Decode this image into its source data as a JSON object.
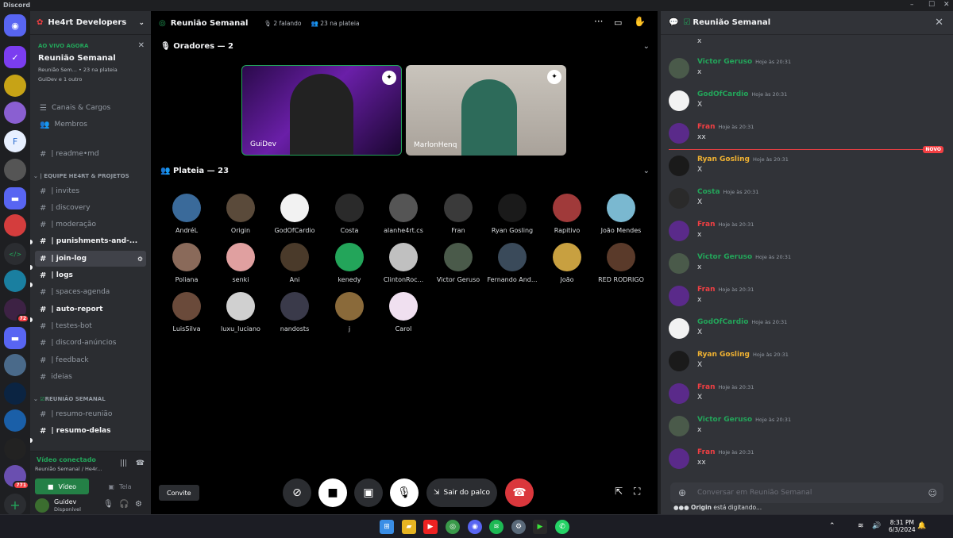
{
  "app": {
    "title": "Discord"
  },
  "guild": {
    "name": "He4rt Developers"
  },
  "live": {
    "label": "AO VIVO AGORA",
    "title": "Reunião Semanal",
    "sub1": "Reunião Sem...",
    "audience": "23 na plateia",
    "sub2": "GuiDev e 1 outro"
  },
  "nav": {
    "roles": "Canais & Cargos",
    "members": "Membros"
  },
  "channels": [
    {
      "label": "| readme•md",
      "bold": false
    },
    {
      "cat": "| EQUIPE HE4RT & PROJETOS"
    },
    {
      "label": "| invites",
      "bold": false
    },
    {
      "label": "| discovery",
      "bold": false
    },
    {
      "label": "| moderação",
      "bold": false
    },
    {
      "label": "| punishments-and-...",
      "bold": true
    },
    {
      "label": "| join-log",
      "bold": true,
      "selected": true
    },
    {
      "label": "| logs",
      "bold": true
    },
    {
      "label": "| spaces-agenda",
      "bold": false
    },
    {
      "label": "| auto-report",
      "bold": true
    },
    {
      "label": "| testes-bot",
      "bold": false
    },
    {
      "label": "| discord-anúncios",
      "bold": false
    },
    {
      "label": "| feedback",
      "bold": false
    },
    {
      "label": "ideias",
      "bold": false
    },
    {
      "cat": "REUNIÃO SEMANAL"
    },
    {
      "label": "| resumo-reunião",
      "bold": false
    },
    {
      "label": "| resumo-delas",
      "bold": true
    }
  ],
  "voice": {
    "status": "Vídeo conectado",
    "where": "Reunião Semanal / He4r...",
    "video": "Vídeo",
    "screen": "Tela"
  },
  "user": {
    "name": "Guidev",
    "status": "Disponível"
  },
  "stage": {
    "title": "Reunião Semanal",
    "speaking": "2 falando",
    "audience": "23 na plateia",
    "speakers_label": "Oradores — 2",
    "audience_label": "Plateia — 23"
  },
  "speakers": [
    {
      "name": "GuiDev"
    },
    {
      "name": "MarlonHenq"
    }
  ],
  "audience": [
    "AndréL",
    "Origin",
    "GodOfCardio",
    "Costa",
    "alanhe4rt.cs",
    "Fran",
    "Ryan Gosling",
    "Rapitivo",
    "João Mendes",
    "Poliana",
    "senki",
    "Ani",
    "kenedy",
    "ClintonRoc...",
    "Victor Geruso",
    "Fernando And...",
    "João",
    "RED RODRIGO",
    "LuisSilva",
    "luxu_luciano",
    "nandosts",
    "j",
    "Carol"
  ],
  "controls": {
    "invite": "Convite",
    "leave": "Sair do palco"
  },
  "chat": {
    "title": "Reunião Semanal",
    "first_text": "x",
    "messages": [
      {
        "author": "Victor Geruso",
        "time": "Hoje às 20:31",
        "text": "x",
        "color": "#23a55a"
      },
      {
        "author": "GodOfCardio",
        "time": "Hoje às 20:31",
        "text": "X",
        "color": "#23a55a"
      },
      {
        "author": "Fran",
        "time": "Hoje às 20:31",
        "text": "xx",
        "color": "#f23f43"
      },
      {
        "author": "Ryan Gosling",
        "time": "Hoje às 20:31",
        "text": "X",
        "color": "#f0b232"
      },
      {
        "author": "Costa",
        "time": "Hoje às 20:31",
        "text": "X",
        "color": "#23a55a"
      },
      {
        "author": "Fran",
        "time": "Hoje às 20:31",
        "text": "x",
        "color": "#f23f43"
      },
      {
        "author": "Victor Geruso",
        "time": "Hoje às 20:31",
        "text": "x",
        "color": "#23a55a"
      },
      {
        "author": "Fran",
        "time": "Hoje às 20:31",
        "text": "x",
        "color": "#f23f43"
      },
      {
        "author": "GodOfCardio",
        "time": "Hoje às 20:31",
        "text": "X",
        "color": "#23a55a"
      },
      {
        "author": "Ryan Gosling",
        "time": "Hoje às 20:31",
        "text": "X",
        "color": "#f0b232"
      },
      {
        "author": "Fran",
        "time": "Hoje às 20:31",
        "text": "X",
        "color": "#f23f43"
      },
      {
        "author": "Victor Geruso",
        "time": "Hoje às 20:31",
        "text": "x",
        "color": "#23a55a"
      },
      {
        "author": "Fran",
        "time": "Hoje às 20:31",
        "text": "xx",
        "color": "#f23f43"
      }
    ],
    "new_badge": "NOVO",
    "placeholder": "Conversar em Reunião Semanal",
    "typing_user": "Origin",
    "typing_text": " está digitando..."
  },
  "server_badges": {
    "a": "72",
    "b": "771"
  },
  "taskbar": {
    "time": "8:31 PM",
    "date": "6/3/2024"
  }
}
